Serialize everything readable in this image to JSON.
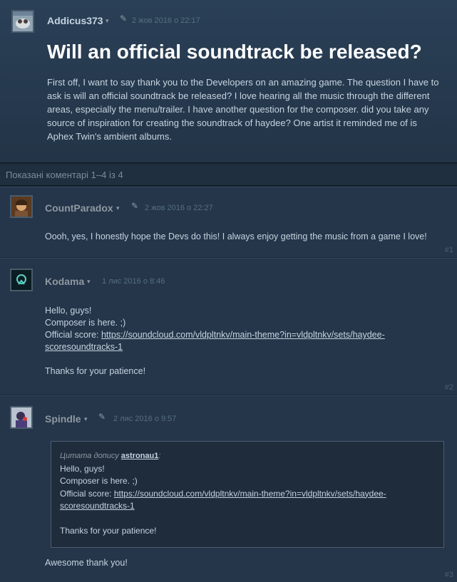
{
  "thread": {
    "author": "Addicus373",
    "timestamp": "2 жов 2016 о 22:17",
    "title": "Will an official soundtrack be released?",
    "body": "First off, I want to say thank you to the Developers on an amazing game. The question I have to ask is will an official soundtrack be released? I love hearing all the music through the different areas, especially the menu/trailer. I have another question for the composer. did you take any source of inspiration for creating the soundtrack of haydee? One artist it reminded me of is Aphex Twin's ambient albums."
  },
  "comment_count": "Показані коментарі 1–4 із 4",
  "comments": [
    {
      "author": "CountParadox",
      "timestamp": "2 жов 2016 о 22:27",
      "text": "Oooh, yes, I honestly hope the Devs do this! I always enjoy getting the music from a game I love!",
      "number": "#1"
    },
    {
      "author": "Kodama",
      "timestamp": "1 лис 2016 о 8:46",
      "line1": "Hello, guys!",
      "line2": "Composer is here. ;)",
      "score_label": "Official score: ",
      "link": "https://soundcloud.com/vldpltnkv/main-theme?in=vldpltnkv/sets/haydee-scoresoundtracks-1",
      "link_line1": "https://soundcloud.com/vldpltnkv/main-theme?in=vldpltnkv/sets/haydee-",
      "link_line2": "scoresoundtracks-1",
      "thanks": "Thanks for your patience!",
      "number": "#2"
    },
    {
      "author": "Spindle",
      "timestamp": "2 лис 2016 о 9:57",
      "quote_prefix": "Цитата допису ",
      "quote_author": "astronau1",
      "quote_suffix": ":",
      "quote_line1": "Hello, guys!",
      "quote_line2": "Composer is here. ;)",
      "quote_score_label": "Official score: ",
      "quote_link_line1": "https://soundcloud.com/vldpltnkv/main-theme?in=vldpltnkv/sets/haydee-",
      "quote_link_line2": "scoresoundtracks-1",
      "quote_thanks": "Thanks for your patience!",
      "text": "Awesome thank you!",
      "number": "#3"
    }
  ],
  "icons": {
    "caret": "▾",
    "pin": "✎"
  }
}
